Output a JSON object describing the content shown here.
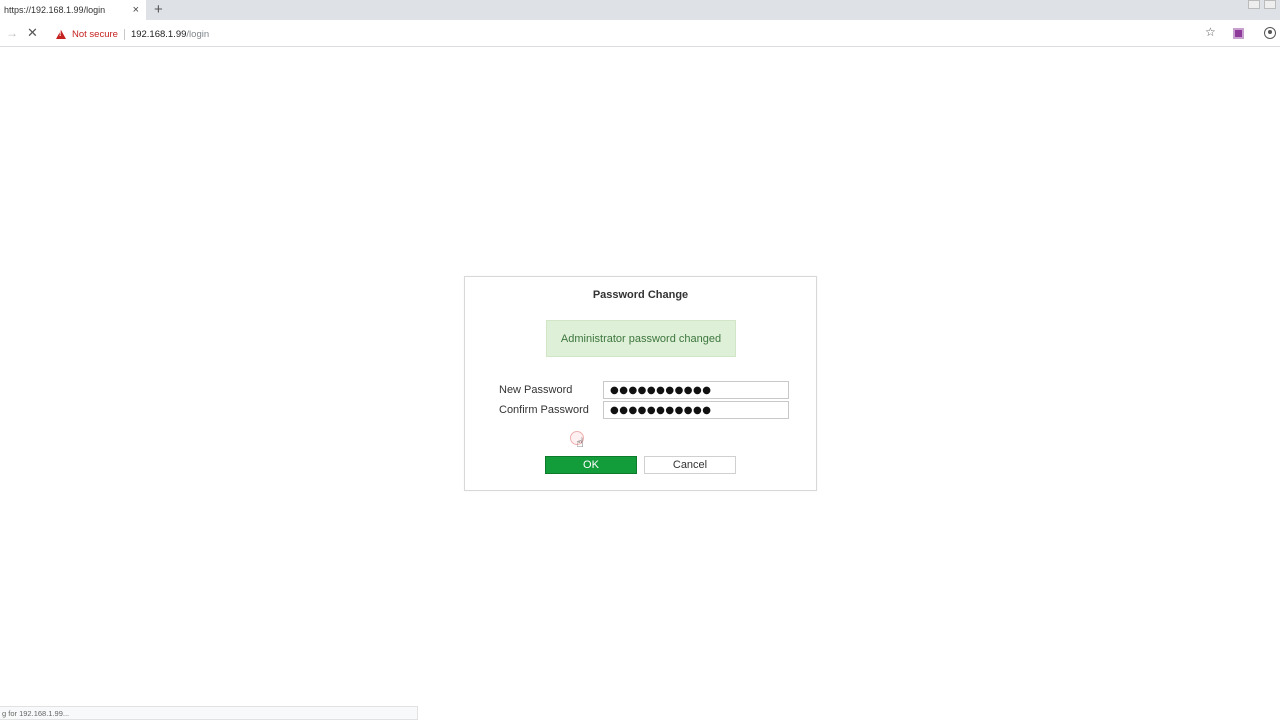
{
  "browser": {
    "tab_title": "https://192.168.1.99/login",
    "tab_close": "×",
    "new_tab": "+",
    "nav_forward": "→",
    "nav_stop": "✕",
    "security_label": "Not secure",
    "url_host": "192.168.1.99",
    "url_path": "/login",
    "bookmark_star": "☆",
    "status_text": "g for 192.168.1.99..."
  },
  "dialog": {
    "title": "Password Change",
    "success_message": "Administrator password changed",
    "new_password_label": "New Password",
    "new_password_value": "●●●●●●●●●●●",
    "confirm_password_label": "Confirm Password",
    "confirm_password_value": "●●●●●●●●●●●",
    "ok_label": "OK",
    "cancel_label": "Cancel"
  },
  "colors": {
    "ok_button": "#139c3a",
    "success_bg": "#dff0d8",
    "success_text": "#3c763d",
    "warning": "#c5221f"
  },
  "icons": {
    "warning": "warning-triangle-icon",
    "star": "star-icon",
    "extension": "extension-icon",
    "profile": "profile-icon",
    "cursor": "hand-cursor-icon"
  }
}
